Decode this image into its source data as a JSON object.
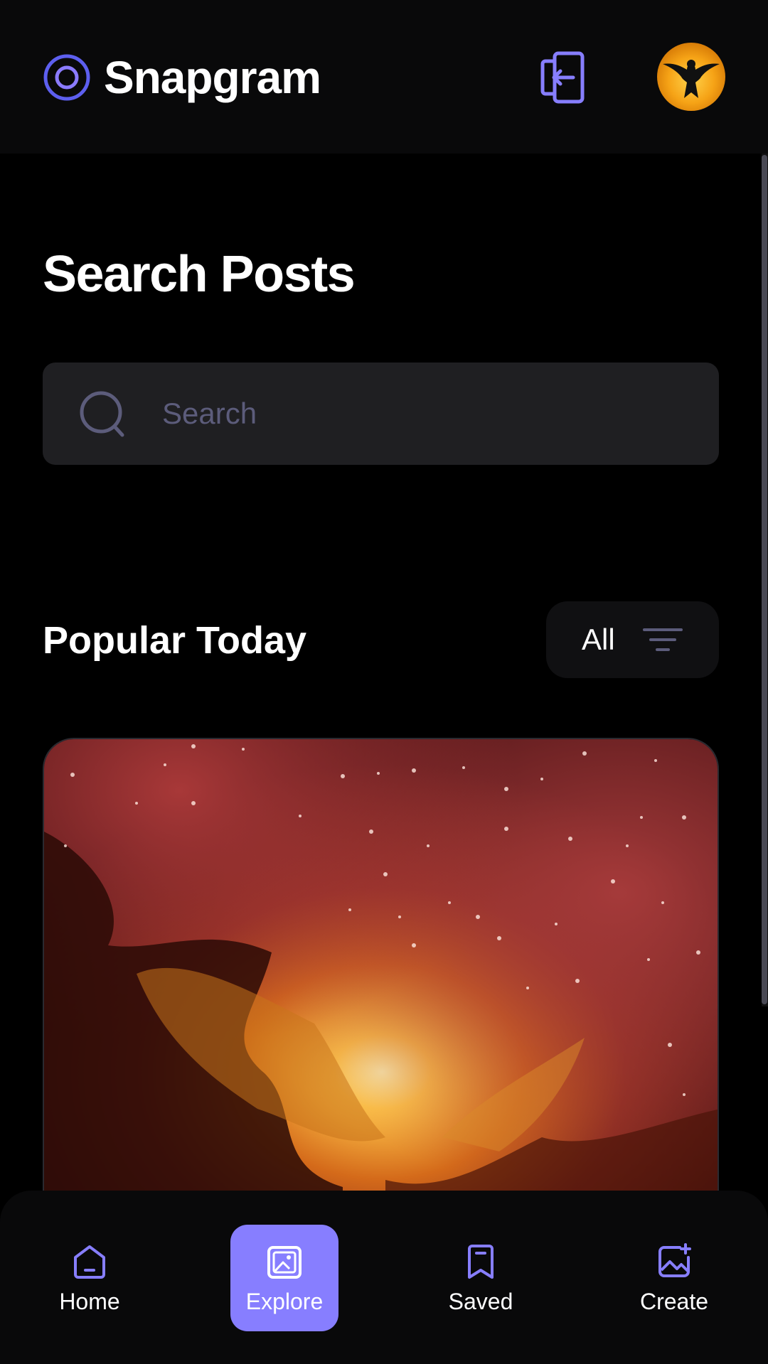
{
  "app": {
    "name": "Snapgram"
  },
  "page": {
    "title": "Search Posts"
  },
  "search": {
    "placeholder": "Search",
    "value": ""
  },
  "popular": {
    "title": "Popular Today",
    "filter_label": "All"
  },
  "bottom_nav": {
    "items": [
      {
        "label": "Home",
        "icon": "home-icon",
        "active": false
      },
      {
        "label": "Explore",
        "icon": "explore-icon",
        "active": true
      },
      {
        "label": "Saved",
        "icon": "bookmark-icon",
        "active": false
      },
      {
        "label": "Create",
        "icon": "create-post-icon",
        "active": false
      }
    ]
  },
  "colors": {
    "accent": "#877eff",
    "logo": "#5d5fef",
    "surface": "#1f1f22",
    "placeholder": "#5c5c7b"
  }
}
